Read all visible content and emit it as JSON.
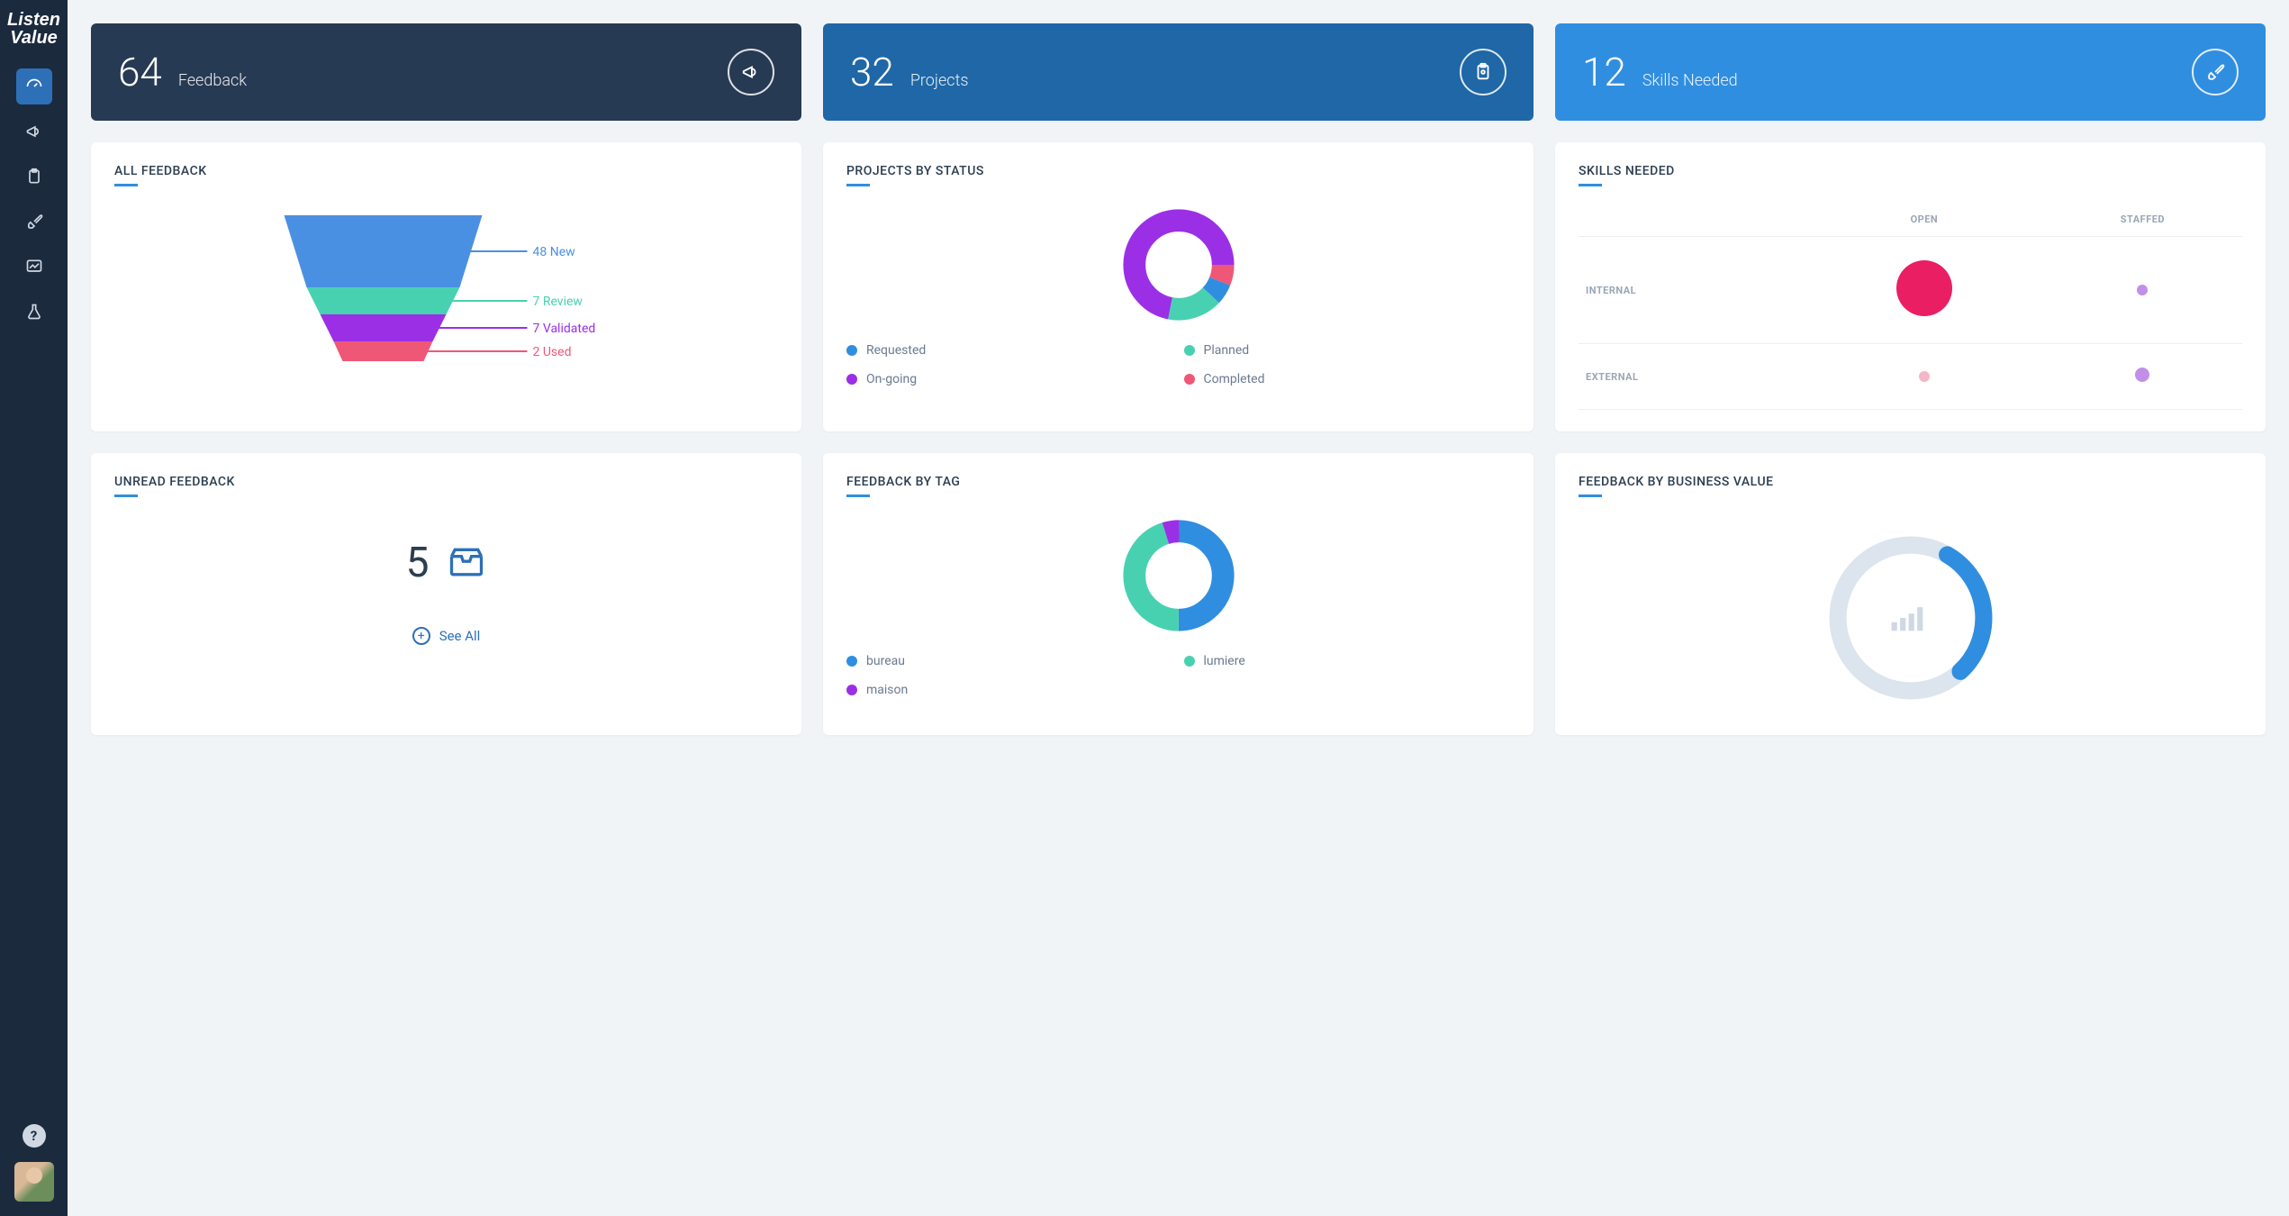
{
  "brand": "Listen Value",
  "sidebar": {
    "items": [
      {
        "name": "dashboard",
        "active": true
      },
      {
        "name": "feedback",
        "active": false
      },
      {
        "name": "projects",
        "active": false
      },
      {
        "name": "skills",
        "active": false
      },
      {
        "name": "analytics",
        "active": false
      },
      {
        "name": "lab",
        "active": false
      }
    ]
  },
  "top_stats": {
    "feedback": {
      "value": "64",
      "label": "Feedback"
    },
    "projects": {
      "value": "32",
      "label": "Projects"
    },
    "skills": {
      "value": "12",
      "label": "Skills Needed"
    }
  },
  "all_feedback_card": {
    "title": "ALL FEEDBACK",
    "stages": [
      {
        "label": "48 New",
        "count": 48,
        "color": "#4a90e2"
      },
      {
        "label": "7 Review",
        "count": 7,
        "color": "#48d1b0"
      },
      {
        "label": "7 Validated",
        "count": 7,
        "color": "#9b2fe6"
      },
      {
        "label": "2 Used",
        "count": 2,
        "color": "#ef5777"
      }
    ]
  },
  "projects_status_card": {
    "title": "PROJECTS BY STATUS",
    "legend": [
      {
        "label": "Requested",
        "color": "#308ee0"
      },
      {
        "label": "Planned",
        "color": "#48d1b0"
      },
      {
        "label": "On-going",
        "color": "#9b2fe6"
      },
      {
        "label": "Completed",
        "color": "#ef5777"
      }
    ]
  },
  "skills_card": {
    "title": "SKILLS NEEDED",
    "cols": [
      "OPEN",
      "STAFFED"
    ],
    "rows": [
      "INTERNAL",
      "EXTERNAL"
    ]
  },
  "unread_card": {
    "title": "UNREAD FEEDBACK",
    "count": "5",
    "see_all": "See All"
  },
  "feedback_tag_card": {
    "title": "FEEDBACK BY TAG",
    "legend": [
      {
        "label": "bureau",
        "color": "#308ee0"
      },
      {
        "label": "lumiere",
        "color": "#48d1b0"
      },
      {
        "label": "maison",
        "color": "#9b2fe6"
      }
    ]
  },
  "biz_value_card": {
    "title": "FEEDBACK BY BUSINESS VALUE"
  },
  "chart_data": [
    {
      "id": "all_feedback_funnel",
      "type": "bar",
      "title": "ALL FEEDBACK",
      "categories": [
        "New",
        "Review",
        "Validated",
        "Used"
      ],
      "values": [
        48,
        7,
        7,
        2
      ],
      "colors": [
        "#4a90e2",
        "#48d1b0",
        "#9b2fe6",
        "#ef5777"
      ]
    },
    {
      "id": "projects_by_status_donut",
      "type": "pie",
      "title": "PROJECTS BY STATUS",
      "categories": [
        "Requested",
        "Planned",
        "On-going",
        "Completed"
      ],
      "values": [
        2,
        5,
        23,
        2
      ],
      "colors": [
        "#308ee0",
        "#48d1b0",
        "#9b2fe6",
        "#ef5777"
      ]
    },
    {
      "id": "skills_needed_bubble",
      "type": "heatmap",
      "title": "SKILLS NEEDED",
      "x": [
        "OPEN",
        "STAFFED"
      ],
      "y": [
        "INTERNAL",
        "EXTERNAL"
      ],
      "values": [
        [
          9,
          1
        ],
        [
          1,
          2
        ]
      ],
      "colors": {
        "INTERNAL_OPEN": "#e91e63",
        "INTERNAL_STAFFED": "#c18fe8",
        "EXTERNAL_OPEN": "#f5b6c9",
        "EXTERNAL_STAFFED": "#c18fe8"
      }
    },
    {
      "id": "feedback_by_tag_donut",
      "type": "pie",
      "title": "FEEDBACK BY TAG",
      "categories": [
        "bureau",
        "lumiere",
        "maison"
      ],
      "values": [
        50,
        45,
        5
      ],
      "colors": [
        "#308ee0",
        "#48d1b0",
        "#9b2fe6"
      ]
    },
    {
      "id": "feedback_by_business_value_gauge",
      "type": "pie",
      "title": "FEEDBACK BY BUSINESS VALUE",
      "categories": [
        "progress",
        "remaining"
      ],
      "values": [
        30,
        70
      ],
      "colors": [
        "#308ee0",
        "#dce4ee"
      ]
    }
  ]
}
